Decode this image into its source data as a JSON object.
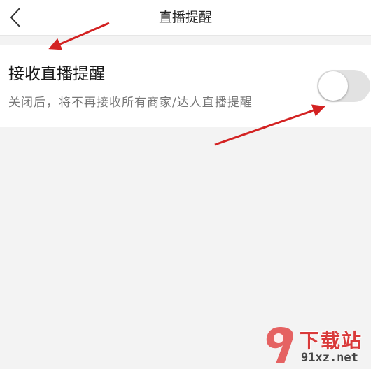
{
  "header": {
    "title": "直播提醒"
  },
  "setting": {
    "title": "接收直播提醒",
    "description": "关闭后，将不再接收所有商家/达人直播提醒",
    "toggle_on": false
  },
  "watermark": {
    "brand": "下载站",
    "domain": "91xz.net"
  },
  "colors": {
    "accent_arrow": "#d32222",
    "toggle_off": "#e2e2e2",
    "background": "#f3f3f3"
  }
}
